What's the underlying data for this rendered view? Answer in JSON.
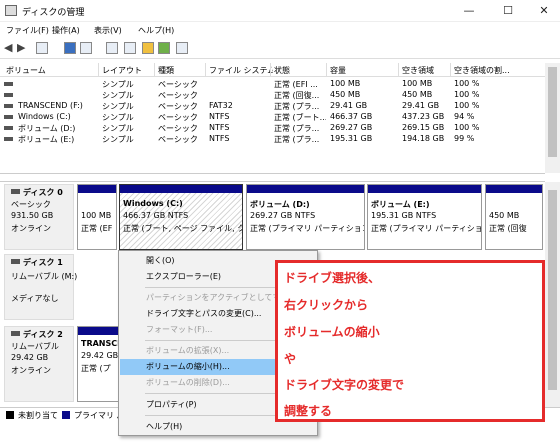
{
  "window": {
    "title": "ディスクの管理",
    "minimize": "—",
    "maximize": "☐",
    "close": "✕"
  },
  "menu": [
    "ファイル(F)",
    "操作(A)",
    "表示(V)",
    "ヘルプ(H)"
  ],
  "columns": [
    "ボリューム",
    "レイアウト",
    "種類",
    "ファイル システム",
    "状態",
    "容量",
    "空き領域",
    "空き領域の割..."
  ],
  "volumes": [
    [
      "",
      "シンプル",
      "ベーシック",
      "",
      "正常 (EFI ...",
      "100 MB",
      "100 MB",
      "100 %"
    ],
    [
      "",
      "シンプル",
      "ベーシック",
      "",
      "正常 (回復...",
      "450 MB",
      "450 MB",
      "100 %"
    ],
    [
      "TRANSCEND (F:)",
      "シンプル",
      "ベーシック",
      "FAT32",
      "正常 (プラ...",
      "29.41 GB",
      "29.41 GB",
      "100 %"
    ],
    [
      "Windows (C:)",
      "シンプル",
      "ベーシック",
      "NTFS",
      "正常 (ブート...",
      "466.37 GB",
      "437.23 GB",
      "94 %"
    ],
    [
      "ボリューム (D:)",
      "シンプル",
      "ベーシック",
      "NTFS",
      "正常 (プラ...",
      "269.27 GB",
      "269.15 GB",
      "100 %"
    ],
    [
      "ボリューム (E:)",
      "シンプル",
      "ベーシック",
      "NTFS",
      "正常 (プラ...",
      "195.31 GB",
      "194.18 GB",
      "99 %"
    ]
  ],
  "disk0": {
    "name": "ディスク 0",
    "type": "ベーシック",
    "size": "931.50 GB",
    "status": "オンライン",
    "partitions": [
      {
        "line1": "",
        "line2": "100 MB",
        "line3": "正常 (EF"
      },
      {
        "line1": "Windows  (C:)",
        "line2": "466.37 GB NTFS",
        "line3": "正常 (ブート, ページ ファイル, クラ"
      },
      {
        "line1": "ボリューム  (D:)",
        "line2": "269.27 GB NTFS",
        "line3": "正常 (プライマリ パーティション)"
      },
      {
        "line1": "ボリューム  (E:)",
        "line2": "195.31 GB NTFS",
        "line3": "正常 (プライマリ パーティション)"
      },
      {
        "line1": "",
        "line2": "450 MB",
        "line3": "正常 (回復"
      }
    ]
  },
  "disk1": {
    "name": "ディスク 1",
    "type": "リムーバブル (M:)",
    "status": "メディアなし"
  },
  "disk2": {
    "name": "ディスク 2",
    "type": "リムーバブル",
    "size": "29.42 GB",
    "status": "オンライン",
    "part_line1": "TRANSCE",
    "part_line2": "29.42 GB F",
    "part_line3": "正常 (プ"
  },
  "legend": {
    "unallocated": "未割り当て",
    "primary": "プライマリ パ"
  },
  "context_menu": {
    "items": [
      {
        "label": "開く(O)",
        "enabled": true
      },
      {
        "label": "エクスプローラー(E)",
        "enabled": true
      },
      {
        "label": "パーティションをアクティブとしてマーク(M)",
        "enabled": false
      },
      {
        "label": "ドライブ文字とパスの変更(C)...",
        "enabled": true
      },
      {
        "label": "フォーマット(F)...",
        "enabled": false
      },
      {
        "label": "ボリュームの拡張(X)...",
        "enabled": false
      },
      {
        "label": "ボリュームの縮小(H)...",
        "enabled": true,
        "highlighted": true
      },
      {
        "label": "ボリュームの削除(D)...",
        "enabled": false
      },
      {
        "label": "プロパティ(P)",
        "enabled": true
      },
      {
        "label": "ヘルプ(H)",
        "enabled": true
      }
    ]
  },
  "annotation": [
    "ドライブ選択後、",
    "右クリックから",
    "ボリュームの縮小",
    "や",
    "ドライブ文字の変更で",
    "調整する"
  ],
  "colors": {
    "primary_partition": "#0a0a8a",
    "unallocated": "#000000",
    "annotation": "#e52b2b",
    "menu_highlight": "#91c9f7"
  }
}
